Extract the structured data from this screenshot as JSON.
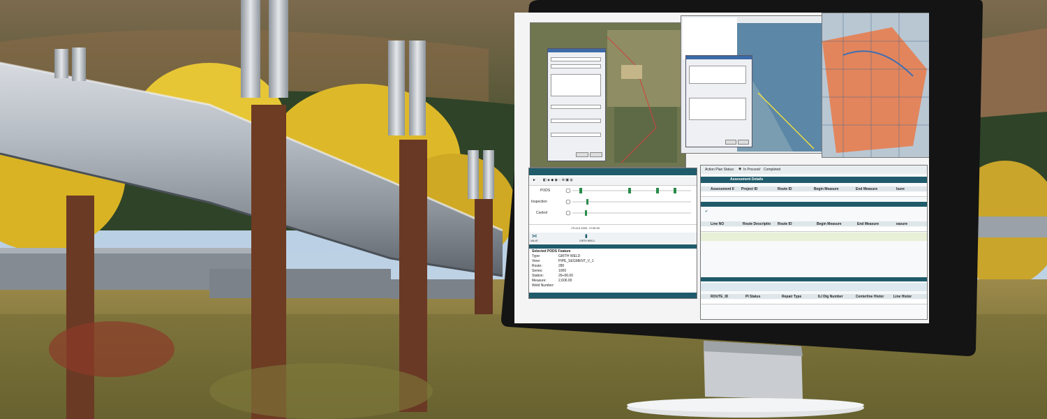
{
  "pods_timeline": {
    "rows": [
      "PODS",
      "Inspection",
      "Control"
    ],
    "readout": "JTL113 1000 : 0+00.00",
    "feature_icons": [
      "VALVE",
      "GIRTH WELD"
    ],
    "selected_title": "Selected PODS Feature",
    "fields": [
      {
        "label": "Type:",
        "value": "GIRTH WELD"
      },
      {
        "label": "View:",
        "value": "PIPE_SEGMENT_V_1"
      },
      {
        "label": "Route:",
        "value": "280"
      },
      {
        "label": "Series:",
        "value": "1000"
      },
      {
        "label": "Station:",
        "value": "26+06.00"
      },
      {
        "label": "Measure:",
        "value": "2,606.00"
      },
      {
        "label": "Weld Number:",
        "value": ""
      }
    ]
  },
  "action_plan": {
    "status_label": "Action Plan Status:",
    "options": [
      "In Process",
      "Completed"
    ],
    "section_title": "Assessment Details",
    "table1_headers": [
      "Assessment II",
      "Project ID",
      "Route ID",
      "Begin Measure",
      "End Measure",
      "Isure"
    ],
    "table2_headers": [
      "Line NO",
      "Route Descriptio",
      "Route ID",
      "Begin Measure",
      "End Measure",
      "easure"
    ],
    "table3_headers": [
      "ROUTE_ID",
      "PI Status",
      "Repair Type",
      "ILI Dig Number",
      "Centerline Histor",
      "Line Histor"
    ]
  },
  "colors": {
    "sky": "#8fb3d6",
    "pipe": "#a9b0b6",
    "support": "#6b3a24",
    "aspen": "#e2c12a",
    "monitor_bezel": "#151515",
    "header_teal": "#1f5b6b"
  },
  "icons": [
    "radio-selected-icon",
    "radio-empty-icon",
    "checkmark-icon",
    "play-icon",
    "valve-icon",
    "weld-icon"
  ]
}
